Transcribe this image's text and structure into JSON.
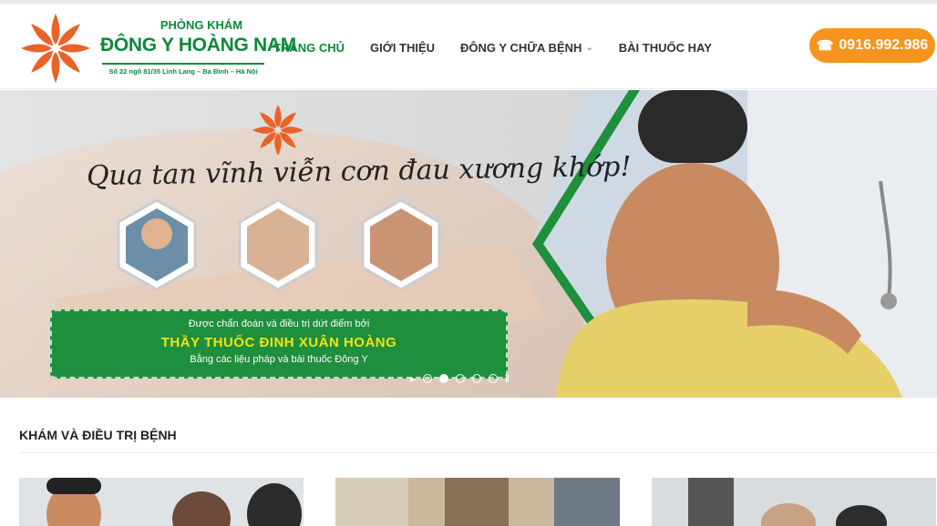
{
  "clinic": {
    "subtitle": "PHÒNG KHÁM",
    "name": "ĐÔNG Y HOÀNG NAM",
    "address": "Số 22 ngõ 81/35 Linh Lang – Ba Đình – Hà Nội"
  },
  "nav": [
    {
      "label": "TRANG CHỦ",
      "active": true
    },
    {
      "label": "GIỚI THIỆU",
      "active": false
    },
    {
      "label": "ĐÔNG Y CHỮA BỆNH",
      "active": false,
      "dropdown": true
    },
    {
      "label": "BÀI THUỐC HAY",
      "active": false
    }
  ],
  "phone": {
    "number": "0916.992.986",
    "icon": "phone-icon"
  },
  "banner": {
    "slogan": "Qua tan vĩnh viễn cơn đau xương khớp!",
    "box_line1": "Được chẩn đoán và điều trị dứt điểm bởi",
    "box_line2": "THẦY THUỐC ĐINH XUÂN HOÀNG",
    "box_line3": "Bằng các liệu pháp và bài thuốc Đông Y",
    "slides": 5,
    "active_slide": 2
  },
  "section": {
    "title": "KHÁM VÀ ĐIỀU TRỊ BỆNH"
  },
  "colors": {
    "brand_green": "#0b8a3a",
    "accent_orange": "#f7941d",
    "flower": "#e8632a"
  }
}
